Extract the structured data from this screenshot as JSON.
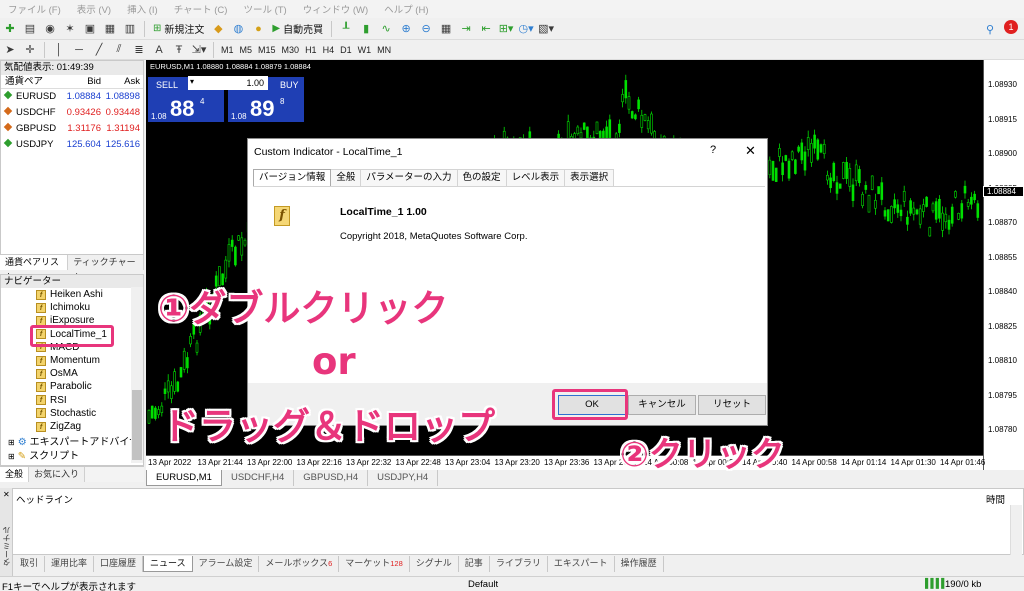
{
  "menu": [
    "ファイル (F)",
    "表示 (V)",
    "挿入 (I)",
    "チャート (C)",
    "ツール (T)",
    "ウィンドウ (W)",
    "ヘルプ (H)"
  ],
  "toolbar": {
    "new_order": "新規注文",
    "auto_trade": "自動売買",
    "notification_count": "1"
  },
  "timeframes": [
    "M1",
    "M5",
    "M15",
    "M30",
    "H1",
    "H4",
    "D1",
    "W1",
    "MN"
  ],
  "market_watch": {
    "title": "気配値表示: 01:49:39",
    "columns": [
      "通貨ペア",
      "Bid",
      "Ask"
    ],
    "rows": [
      {
        "symbol": "EURUSD",
        "bid": "1.08884",
        "ask": "1.08898",
        "color": "#2e9e2e",
        "bid_color": "#1a3fd0",
        "ask_color": "#1a3fd0"
      },
      {
        "symbol": "USDCHF",
        "bid": "0.93426",
        "ask": "0.93448",
        "color": "#d46a1a",
        "bid_color": "#e01f1f",
        "ask_color": "#e01f1f"
      },
      {
        "symbol": "GBPUSD",
        "bid": "1.31176",
        "ask": "1.31194",
        "color": "#d46a1a",
        "bid_color": "#e01f1f",
        "ask_color": "#e01f1f"
      },
      {
        "symbol": "USDJPY",
        "bid": "125.604",
        "ask": "125.616",
        "color": "#2e9e2e",
        "bid_color": "#1a3fd0",
        "ask_color": "#1a3fd0"
      }
    ],
    "tabs": [
      "通貨ペアリスト",
      "ティックチャート"
    ]
  },
  "navigator": {
    "title": "ナビゲーター",
    "items": [
      "Heiken Ashi",
      "Ichimoku",
      "iExposure",
      "LocalTime_1",
      "MACD",
      "Momentum",
      "OsMA",
      "Parabolic",
      "RSI",
      "Stochastic",
      "ZigZag"
    ],
    "groups": [
      "エキスパートアドバイザ",
      "スクリプト"
    ],
    "tabs": [
      "全般",
      "お気に入り"
    ]
  },
  "chart": {
    "label": "EURUSD,M1  1.08880 1.08884 1.08879 1.08884",
    "sell_label": "SELL",
    "buy_label": "BUY",
    "lot": "1.00",
    "sell_prefix": "1.08",
    "sell_big": "88",
    "sell_sup": "4",
    "buy_prefix": "1.08",
    "buy_big": "89",
    "buy_sup": "8",
    "current_price": "1.08884",
    "y_labels": [
      "1.08930",
      "1.08915",
      "1.08900",
      "1.08885",
      "1.08870",
      "1.08855",
      "1.08840",
      "1.08825",
      "1.08810",
      "1.08795",
      "1.08780"
    ],
    "x_labels": [
      "13 Apr 2022",
      "13 Apr 21:44",
      "13 Apr 22:00",
      "13 Apr 22:16",
      "13 Apr 22:32",
      "13 Apr 22:48",
      "13 Apr 23:04",
      "13 Apr 23:20",
      "13 Apr 23:36",
      "13 Apr 23:52",
      "14 Apr 00:08",
      "14 Apr 00:24",
      "14 Apr 00:40",
      "14 Apr 00:58",
      "14 Apr 01:14",
      "14 Apr 01:30",
      "14 Apr 01:46"
    ],
    "tabs": [
      "EURUSD,M1",
      "USDCHF,H4",
      "GBPUSD,H4",
      "USDJPY,H4"
    ],
    "candle_color": "#00e000"
  },
  "dialog": {
    "title": "Custom Indicator - LocalTime_1",
    "help": "?",
    "close": "✕",
    "tabs": [
      "バージョン情報",
      "全般",
      "パラメーターの入力",
      "色の設定",
      "レベル表示",
      "表示選択"
    ],
    "indicator_name": "LocalTime_1 1.00",
    "copyright": "Copyright 2018, MetaQuotes Software Corp.",
    "ok": "OK",
    "cancel": "キャンセル",
    "reset": "リセット"
  },
  "terminal": {
    "side_label": "ターミナル",
    "headline": "ヘッドライン",
    "time": "時間",
    "tabs": [
      {
        "label": "取引",
        "badge": ""
      },
      {
        "label": "運用比率",
        "badge": ""
      },
      {
        "label": "口座履歴",
        "badge": ""
      },
      {
        "label": "ニュース",
        "badge": ""
      },
      {
        "label": "アラーム設定",
        "badge": ""
      },
      {
        "label": "メールボックス",
        "badge": "6"
      },
      {
        "label": "マーケット",
        "badge": "128"
      },
      {
        "label": "シグナル",
        "badge": ""
      },
      {
        "label": "記事",
        "badge": ""
      },
      {
        "label": "ライブラリ",
        "badge": ""
      },
      {
        "label": "エキスパート",
        "badge": ""
      },
      {
        "label": "操作履歴",
        "badge": ""
      }
    ]
  },
  "status": {
    "help": "F1キーでヘルプが表示されます",
    "profile": "Default",
    "traffic": "190/0 kb"
  },
  "annotations": {
    "step1": "①ダブルクリック",
    "or": "or",
    "drag": "ドラッグ＆ドロップ",
    "step2": "②クリック",
    "color": "#e8357c"
  }
}
